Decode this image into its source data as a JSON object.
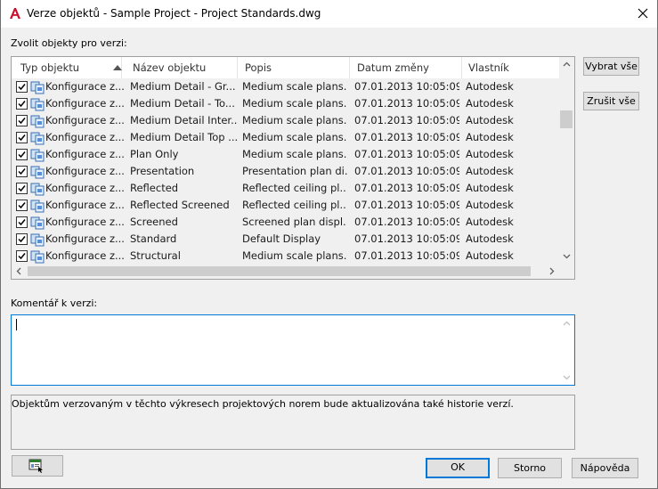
{
  "window": {
    "title": "Verze objektů - Sample Project - Project Standards.dwg"
  },
  "select_label": "Zvolit objekty pro verzi:",
  "table": {
    "columns": [
      "Typ objektu",
      "Název objektu",
      "Popis",
      "Datum změny",
      "Vlastník"
    ],
    "rows": [
      {
        "type": "Konfigurace z...",
        "name": "Medium Detail - Gr...",
        "desc": "Medium scale plans...",
        "date": "07.01.2013 10:05:09",
        "owner": "Autodesk",
        "checked": true
      },
      {
        "type": "Konfigurace z...",
        "name": "Medium Detail - To...",
        "desc": "Medium scale plans...",
        "date": "07.01.2013 10:05:09",
        "owner": "Autodesk",
        "checked": true
      },
      {
        "type": "Konfigurace z...",
        "name": "Medium Detail Inter...",
        "desc": "Medium scale plans...",
        "date": "07.01.2013 10:05:09",
        "owner": "Autodesk",
        "checked": true
      },
      {
        "type": "Konfigurace z...",
        "name": "Medium Detail Top ...",
        "desc": "Medium scale plans...",
        "date": "07.01.2013 10:05:09",
        "owner": "Autodesk",
        "checked": true
      },
      {
        "type": "Konfigurace z...",
        "name": "Plan Only",
        "desc": "Medium scale plans...",
        "date": "07.01.2013 10:05:09",
        "owner": "Autodesk",
        "checked": true
      },
      {
        "type": "Konfigurace z...",
        "name": "Presentation",
        "desc": "Presentation plan di...",
        "date": "07.01.2013 10:05:09",
        "owner": "Autodesk",
        "checked": true
      },
      {
        "type": "Konfigurace z...",
        "name": "Reflected",
        "desc": "Reflected ceiling pl...",
        "date": "07.01.2013 10:05:09",
        "owner": "Autodesk",
        "checked": true
      },
      {
        "type": "Konfigurace z...",
        "name": "Reflected Screened",
        "desc": "Reflected ceiling pl...",
        "date": "07.01.2013 10:05:09",
        "owner": "Autodesk",
        "checked": true
      },
      {
        "type": "Konfigurace z...",
        "name": "Screened",
        "desc": "Screened plan displ...",
        "date": "07.01.2013 10:05:09",
        "owner": "Autodesk",
        "checked": true
      },
      {
        "type": "Konfigurace z...",
        "name": "Standard",
        "desc": "Default Display",
        "date": "07.01.2013 10:05:09",
        "owner": "Autodesk",
        "checked": true
      },
      {
        "type": "Konfigurace z...",
        "name": "Structural",
        "desc": "Medium scale plans...",
        "date": "07.01.2013 10:05:09",
        "owner": "Autodesk",
        "checked": true
      }
    ]
  },
  "buttons": {
    "select_all": "Vybrat vše",
    "cancel_all": "Zrušit vše",
    "ok": "OK",
    "cancel": "Storno",
    "help": "Nápověda"
  },
  "comment": {
    "label": "Komentář k verzi:",
    "value": ""
  },
  "info_text": "Objektům verzovaným v těchto výkresech projektových norem bude aktualizována také historie verzí.",
  "colors": {
    "accent": "#0078d7",
    "app_red": "#c8102e"
  }
}
